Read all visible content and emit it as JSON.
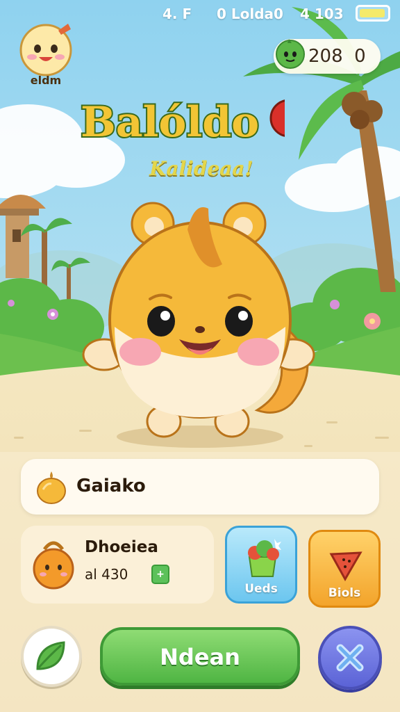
{
  "status_bar": {
    "left": "4. F",
    "middle": "0 Lolda0",
    "right": "4 103"
  },
  "player": {
    "name": "eldm"
  },
  "currency": {
    "value": "208  0",
    "icon": "green-fruit-icon"
  },
  "title": {
    "main": "Balóldo",
    "subtitle": "Kalideaa!"
  },
  "item_row": {
    "label": "Gaiako",
    "icon": "onion-icon"
  },
  "bag": {
    "title": "Dhoeiea",
    "amount": "al 430",
    "plus_icon": "plus-icon"
  },
  "shop": {
    "upgrades_label": "Ueds",
    "deals_label": "Biols"
  },
  "actions": {
    "main_label": "Ndean",
    "leaf_icon": "leaf-icon",
    "close_icon": "close-icon"
  },
  "colors": {
    "sky": "#bfe3f4",
    "grass": "#7cc65a",
    "path": "#f1e2b8",
    "pet_orange": "#f5b93a",
    "main_button": "#5cc14d",
    "close_button": "#6a72e0"
  }
}
